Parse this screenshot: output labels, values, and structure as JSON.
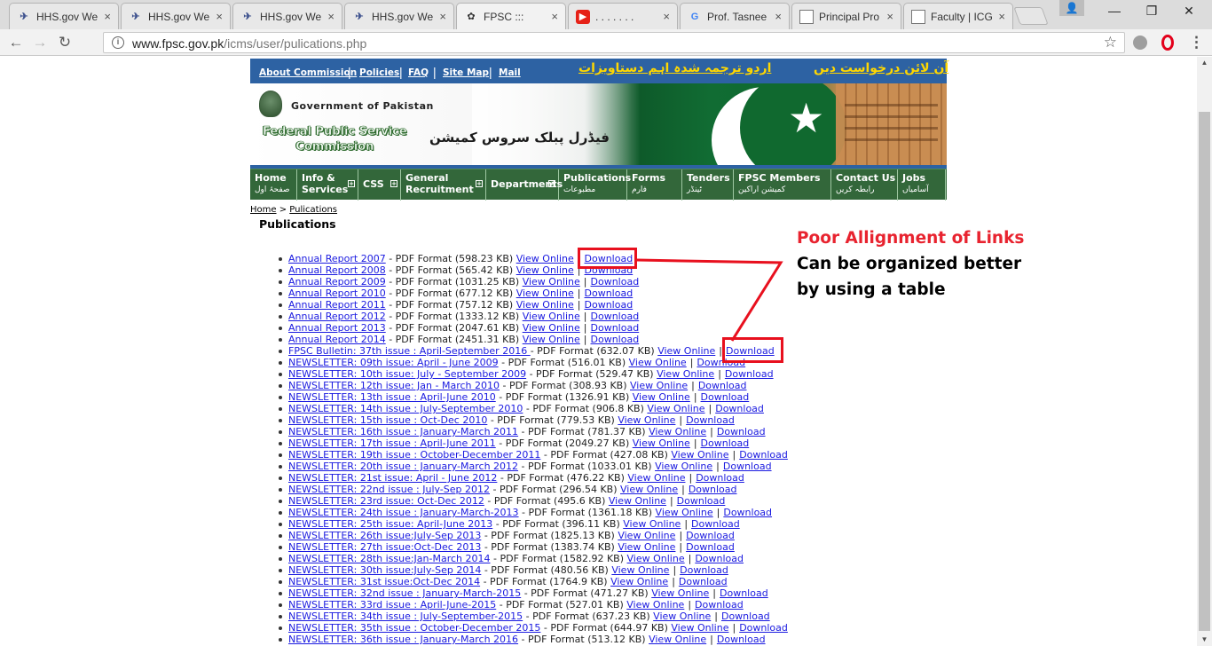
{
  "browser": {
    "tabs": [
      {
        "title": "HHS.gov We",
        "favicon": "hhs-icon",
        "active": false
      },
      {
        "title": "HHS.gov We",
        "favicon": "hhs-icon",
        "active": false
      },
      {
        "title": "HHS.gov We",
        "favicon": "hhs-icon",
        "active": false
      },
      {
        "title": "HHS.gov We",
        "favicon": "hhs-icon",
        "active": false
      },
      {
        "title": "FPSC :::",
        "favicon": "fpsc-icon",
        "active": true
      },
      {
        "title": ". . . . . . .",
        "favicon": "youtube-icon",
        "active": false
      },
      {
        "title": "Prof. Tasnee",
        "favicon": "google-icon",
        "active": false
      },
      {
        "title": "Principal Pro",
        "favicon": "document-icon",
        "active": false
      },
      {
        "title": "Faculty | ICG",
        "favicon": "document-icon",
        "active": false
      }
    ],
    "tab_close": "×",
    "url_host": "www.fpsc.gov.pk",
    "url_path": "/icms/user/pulications.php",
    "window_controls": {
      "minimize": "—",
      "restore": "❐",
      "close": "✕"
    },
    "nav": {
      "back": "←",
      "forward": "→",
      "reload": "↻"
    },
    "icons": {
      "star": "☆",
      "menu": "⋮",
      "info": "i",
      "profile": "👤"
    }
  },
  "site": {
    "top_links": [
      "About Commission",
      "Policies",
      "FAQ",
      "Site Map",
      "Mail"
    ],
    "urdu_links": [
      "اردو ترجمہ شدہ اہم دستاویزات",
      "آن لائن درخواست دیں"
    ],
    "gov_text": "Government of Pakistan",
    "fpsc_name_line1": "Federal Public Service",
    "fpsc_name_line2": "Commission",
    "fpsc_urdu": "فیڈرل پبلک سروس کمیشن",
    "nav": [
      {
        "label": "Home",
        "sub": "صفحۂ اول",
        "plus": false
      },
      {
        "label": "Info &",
        "sub": "Services",
        "plus": true,
        "sub_is_en": true
      },
      {
        "label": "CSS",
        "sub": "",
        "plus": true
      },
      {
        "label": "General",
        "sub": "Recruitment",
        "plus": true,
        "sub_is_en": true
      },
      {
        "label": "Departments",
        "sub": "",
        "plus": true
      },
      {
        "label": "Publications",
        "sub": "مطبوعات",
        "plus": false
      },
      {
        "label": "Forms",
        "sub": "فارم",
        "plus": false
      },
      {
        "label": "Tenders",
        "sub": "ٹینڈر",
        "plus": false
      },
      {
        "label": "FPSC Members",
        "sub": "کمیشن اراکین",
        "plus": false
      },
      {
        "label": "Contact Us",
        "sub": "رابطہ کریں",
        "plus": false
      },
      {
        "label": "Jobs",
        "sub": "آسامیاں",
        "plus": false
      }
    ]
  },
  "breadcrumb": {
    "home": "Home",
    "separator": ">",
    "current": "Pulications"
  },
  "page_title": "Publications",
  "publications": [
    {
      "title": "Annual Report 2007",
      "size": "598.23 KB"
    },
    {
      "title": "Annual Report 2008",
      "size": "565.42 KB"
    },
    {
      "title": "Annual Report 2009",
      "size": "1031.25 KB"
    },
    {
      "title": "Annual Report 2010",
      "size": "677.12 KB"
    },
    {
      "title": "Annual Report 2011",
      "size": "757.12 KB"
    },
    {
      "title": "Annual Report 2012",
      "size": "1333.12 KB"
    },
    {
      "title": "Annual Report 2013",
      "size": "2047.61 KB"
    },
    {
      "title": "Annual Report 2014",
      "size": "2451.31 KB"
    },
    {
      "title": "FPSC Bulletin: 37th issue : April-September 2016 ",
      "size": "632.07 KB"
    },
    {
      "title": "NEWSLETTER: 09th issue: April - June 2009",
      "size": "516.01 KB"
    },
    {
      "title": "NEWSLETTER: 10th issue: July - September 2009",
      "size": "529.47 KB"
    },
    {
      "title": "NEWSLETTER: 12th issue: Jan - March 2010",
      "size": "308.93 KB"
    },
    {
      "title": "NEWSLETTER: 13th issue : April-June 2010",
      "size": "1326.91 KB"
    },
    {
      "title": "NEWSLETTER: 14th issue : July-September 2010",
      "size": "906.8 KB"
    },
    {
      "title": "NEWSLETTER: 15th issue : Oct-Dec 2010",
      "size": "779.53 KB"
    },
    {
      "title": "NEWSLETTER: 16th issue : January-March 2011",
      "size": "781.37 KB"
    },
    {
      "title": "NEWSLETTER: 17th issue : April-June 2011",
      "size": "2049.27 KB"
    },
    {
      "title": "NEWSLETTER: 19th issue : October-December 2011",
      "size": "427.08 KB"
    },
    {
      "title": "NEWSLETTER: 20th issue : January-March 2012",
      "size": "1033.01 KB"
    },
    {
      "title": "NEWSLETTER: 21st issue: April - June 2012",
      "size": "476.22 KB"
    },
    {
      "title": "NEWSLETTER: 22nd issue : July-Sep 2012",
      "size": "296.54 KB"
    },
    {
      "title": "NEWSLETTER: 23rd issue: Oct-Dec 2012",
      "size": "495.6 KB"
    },
    {
      "title": "NEWSLETTER: 24th issue : January-March-2013",
      "size": "1361.18 KB"
    },
    {
      "title": "NEWSLETTER: 25th issue: April-June 2013",
      "size": "396.11 KB"
    },
    {
      "title": "NEWSLETTER: 26th issue:July-Sep 2013",
      "size": "1825.13 KB"
    },
    {
      "title": "NEWSLETTER: 27th issue:Oct-Dec 2013",
      "size": "1383.74 KB"
    },
    {
      "title": "NEWSLETTER: 28th issue:Jan-March 2014",
      "size": "1582.92 KB"
    },
    {
      "title": "NEWSLETTER: 30th issue:July-Sep 2014",
      "size": "480.56 KB"
    },
    {
      "title": "NEWSLETTER: 31st issue:Oct-Dec 2014",
      "size": "1764.9 KB"
    },
    {
      "title": "NEWSLETTER: 32nd issue : January-March-2015",
      "size": "471.27 KB"
    },
    {
      "title": "NEWSLETTER: 33rd issue : April-June-2015",
      "size": "527.01 KB"
    },
    {
      "title": "NEWSLETTER: 34th issue : July-September-2015",
      "size": "637.23 KB"
    },
    {
      "title": "NEWSLETTER: 35th issue : October-December 2015",
      "size": "644.97 KB"
    },
    {
      "title": "NEWSLETTER: 36th issue : January-March 2016",
      "size": "513.12 KB"
    }
  ],
  "pub_format_prefix": " - PDF Format (",
  "pub_format_suffix": ")",
  "view_online_label": "View Online",
  "download_label": "Download",
  "link_separator": "|",
  "annotation": {
    "title": "Poor Allignment of Links",
    "line1": "Can be organized better",
    "line2": "by using a table",
    "color": "#e8232f"
  }
}
